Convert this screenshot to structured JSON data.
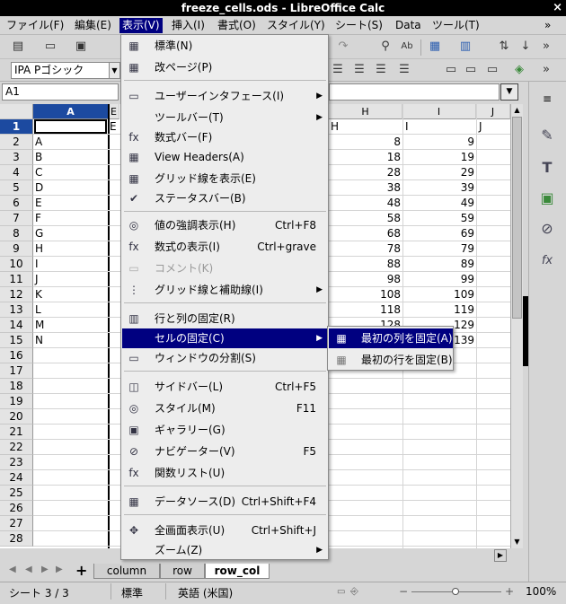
{
  "window": {
    "title": "freeze_cells.ods - LibreOffice Calc",
    "close": "×"
  },
  "menubar": [
    {
      "label": "ファイル(F)"
    },
    {
      "label": "編集(E)"
    },
    {
      "label": "表示(V)"
    },
    {
      "label": "挿入(I)"
    },
    {
      "label": "書式(O)"
    },
    {
      "label": "スタイル(Y)"
    },
    {
      "label": "シート(S)"
    },
    {
      "label": "Data"
    },
    {
      "label": "ツール(T)"
    },
    {
      "label": "»"
    }
  ],
  "toolbar": {
    "font_name": "IPA Pゴシック",
    "overflow": "»"
  },
  "formula": {
    "name_box": "A1"
  },
  "grid": {
    "col_headers": [
      "A",
      "E",
      "H",
      "I",
      "J"
    ],
    "row_numbers": [
      "1",
      "2",
      "3",
      "4",
      "5",
      "6",
      "7",
      "8",
      "9",
      "10",
      "11",
      "12",
      "13",
      "14",
      "15",
      "16",
      "17",
      "18",
      "19",
      "20",
      "21",
      "22",
      "23",
      "24",
      "25",
      "26",
      "27",
      "28"
    ],
    "row1_labels": {
      "col2": "E",
      "col3": "H",
      "col4": "I",
      "col5": "J"
    },
    "col_a": [
      "A",
      "B",
      "C",
      "D",
      "E",
      "F",
      "G",
      "H",
      "I",
      "J",
      "K",
      "L",
      "M",
      "N"
    ],
    "col_h": [
      "8",
      "18",
      "28",
      "38",
      "48",
      "58",
      "68",
      "78",
      "88",
      "98",
      "108",
      "118",
      "128",
      "138"
    ],
    "col_i": [
      "9",
      "19",
      "29",
      "39",
      "49",
      "59",
      "69",
      "79",
      "89",
      "99",
      "109",
      "119",
      "129",
      "139"
    ]
  },
  "view_menu": {
    "items": [
      {
        "icon": "normal-view-icon",
        "label": "標準(N)",
        "shortcut": "",
        "arrow": false
      },
      {
        "icon": "page-break-icon",
        "label": "改ページ(P)",
        "shortcut": "",
        "arrow": false
      },
      {
        "icon": "ui-icon",
        "label": "ユーザーインタフェース(I)",
        "shortcut": "",
        "arrow": true
      },
      {
        "icon": "",
        "label": "ツールバー(T)",
        "shortcut": "",
        "arrow": true
      },
      {
        "icon": "fx-icon",
        "label": "数式バー(F)",
        "shortcut": "",
        "arrow": false
      },
      {
        "icon": "headers-icon",
        "label": "View Headers(A)",
        "shortcut": "",
        "arrow": false
      },
      {
        "icon": "gridlines-icon",
        "label": "グリッド線を表示(E)",
        "shortcut": "",
        "arrow": false
      },
      {
        "icon": "check-icon",
        "label": "ステータスバー(B)",
        "shortcut": "",
        "arrow": false
      },
      {
        "icon": "highlight-icon",
        "label": "値の強調表示(H)",
        "shortcut": "Ctrl+F8",
        "arrow": false
      },
      {
        "icon": "formula-display-icon",
        "label": "数式の表示(I)",
        "shortcut": "Ctrl+grave",
        "arrow": false
      },
      {
        "icon": "comment-icon",
        "label": "コメント(K)",
        "shortcut": "",
        "arrow": false
      },
      {
        "icon": "grid-helplines-icon",
        "label": "グリッド線と補助線(I)",
        "shortcut": "",
        "arrow": true
      },
      {
        "icon": "freeze-rows-cols-icon",
        "label": "行と列の固定(R)",
        "shortcut": "",
        "arrow": false
      },
      {
        "icon": "",
        "label": "セルの固定(C)",
        "shortcut": "",
        "arrow": true
      },
      {
        "icon": "split-window-icon",
        "label": "ウィンドウの分割(S)",
        "shortcut": "",
        "arrow": false
      },
      {
        "icon": "sidebar-icon",
        "label": "サイドバー(L)",
        "shortcut": "Ctrl+F5",
        "arrow": false
      },
      {
        "icon": "styles-icon",
        "label": "スタイル(M)",
        "shortcut": "F11",
        "arrow": false
      },
      {
        "icon": "gallery-icon",
        "label": "ギャラリー(G)",
        "shortcut": "",
        "arrow": false
      },
      {
        "icon": "navigator-icon",
        "label": "ナビゲーター(V)",
        "shortcut": "F5",
        "arrow": false
      },
      {
        "icon": "function-list-icon",
        "label": "関数リスト(U)",
        "shortcut": "",
        "arrow": false
      },
      {
        "icon": "datasource-icon",
        "label": "データソース(D)",
        "shortcut": "Ctrl+Shift+F4",
        "arrow": false
      },
      {
        "icon": "fullscreen-icon",
        "label": "全画面表示(U)",
        "shortcut": "Ctrl+Shift+J",
        "arrow": false
      },
      {
        "icon": "",
        "label": "ズーム(Z)",
        "shortcut": "",
        "arrow": true
      }
    ]
  },
  "freeze_submenu": {
    "items": [
      {
        "label": "最初の列を固定(A)"
      },
      {
        "label": "最初の行を固定(B)"
      }
    ]
  },
  "sheet_tabs": {
    "tabs": [
      "column",
      "row",
      "row_col"
    ],
    "active": "row_col",
    "add": "+"
  },
  "status": {
    "sheet": "シート 3 / 3",
    "page_style": "標準",
    "language": "英語 (米国)",
    "zoom_out": "−",
    "zoom_in": "+",
    "zoom": "100%"
  },
  "sidebar": {
    "menu": "≡"
  }
}
